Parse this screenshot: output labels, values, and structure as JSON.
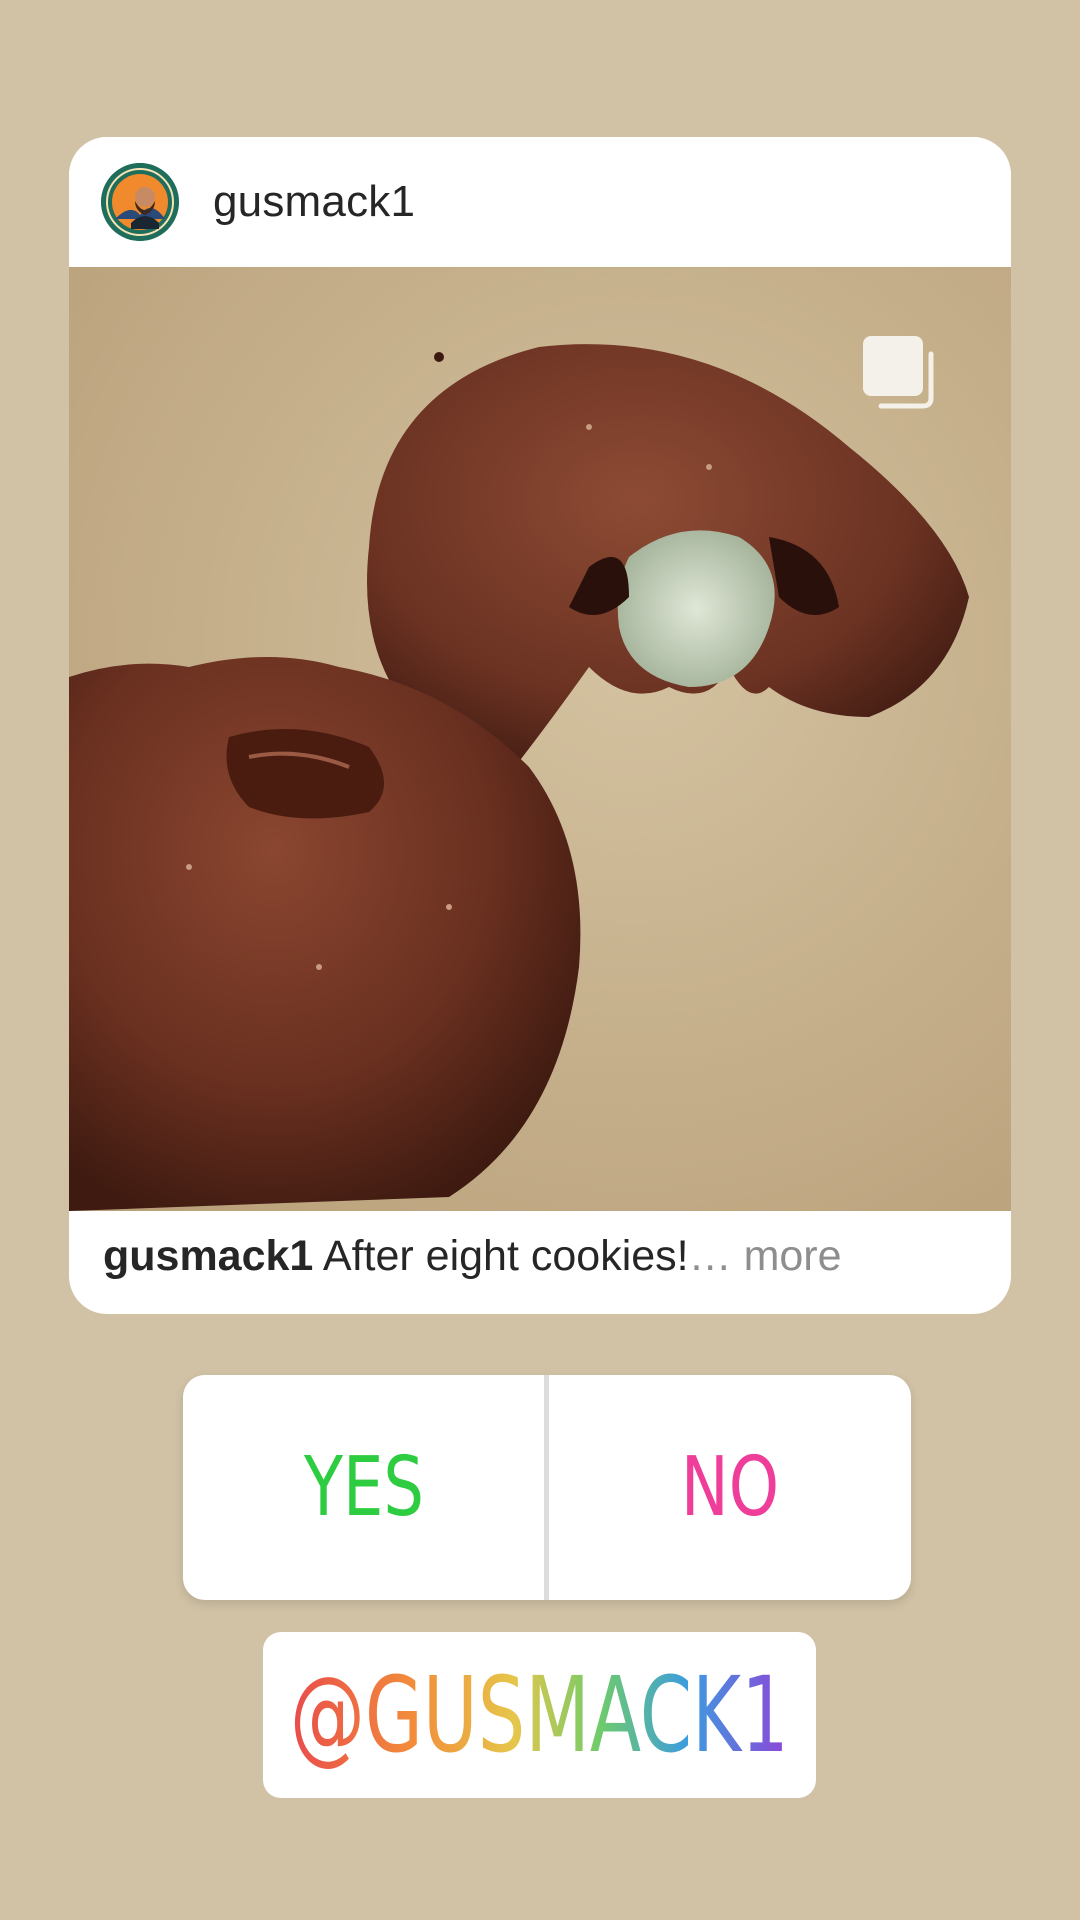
{
  "post": {
    "username": "gusmack1",
    "caption": {
      "username": "gusmack1",
      "text": "After eight cookies!",
      "more": "… more"
    },
    "avatar_icon": "foodie-gusmack1-logo-avatar",
    "multi_image_icon": "carousel-icon"
  },
  "poll": {
    "yes_label": "YES",
    "no_label": "NO",
    "yes_color": "#2ecc40",
    "no_color": "#ee3e9a"
  },
  "mention": {
    "text": "@GUSMACK1"
  },
  "colors": {
    "background": "#d1c2a5",
    "card": "#ffffff"
  }
}
